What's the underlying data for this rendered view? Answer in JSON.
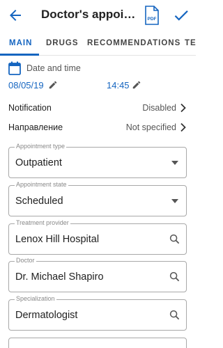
{
  "appbar": {
    "title": "Doctor's appointment",
    "back_icon": "arrow-back-icon",
    "pdf_icon": "pdf-file-icon",
    "pdf_label": "PDF",
    "save_icon": "checkmark-icon"
  },
  "tabs": [
    {
      "label": "MAIN",
      "active": true
    },
    {
      "label": "DRUGS",
      "active": false
    },
    {
      "label": "RECOMMENDATIONS",
      "active": false
    },
    {
      "label": "TE",
      "active": false
    }
  ],
  "datetime": {
    "label": "Date and time",
    "date": "08/05/19",
    "time": "14:45"
  },
  "settings": [
    {
      "label": "Notification",
      "value": "Disabled"
    },
    {
      "label": "Направление",
      "value": "Not specified"
    }
  ],
  "fields": {
    "appointment_type": {
      "label": "Appointment type",
      "value": "Outpatient"
    },
    "appointment_state": {
      "label": "Appointment state",
      "value": "Scheduled"
    },
    "treatment_provider": {
      "label": "Treatment provider",
      "value": "Lenox Hill Hospital"
    },
    "doctor": {
      "label": "Doctor",
      "value": "Dr. Michael Shapiro"
    },
    "specialization": {
      "label": "Specialization",
      "value": "Dermatologist"
    }
  },
  "colors": {
    "accent": "#1565c0",
    "text": "#212121",
    "secondary": "#555555"
  }
}
